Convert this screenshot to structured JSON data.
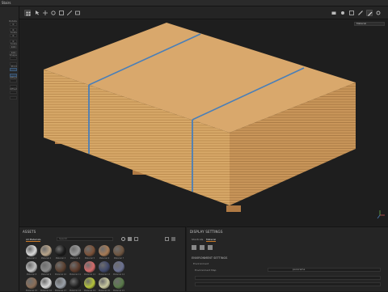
{
  "app": {
    "title": "Stairs"
  },
  "toolbar": {
    "view_dropdown": "Material"
  },
  "left_panel": {
    "fields": [
      {
        "label": "Rotate",
        "value": "0"
      },
      {
        "label": "",
        "value": "0"
      },
      {
        "label": "Scale",
        "value": "0"
      },
      {
        "label": "",
        "value": "0"
      },
      {
        "label": "Scale",
        "value": "100"
      },
      {
        "label": "",
        "value": "100"
      },
      {
        "label": "Shape",
        "value": ""
      },
      {
        "label": "",
        "value": ""
      },
      {
        "label": "Pivot",
        "value": ""
      },
      {
        "label": "",
        "value": ""
      },
      {
        "label": "Offset",
        "value": ""
      },
      {
        "label": "",
        "value": ""
      },
      {
        "label": "Offset",
        "value": ""
      },
      {
        "label": "",
        "value": ""
      }
    ]
  },
  "assets": {
    "title": "ASSETS",
    "tab_label": "All Materials",
    "search_placeholder": "Search",
    "materials": [
      {
        "label": "Material 1",
        "color": "#d9d9d9"
      },
      {
        "label": "Material 2",
        "color": "#b8a48a"
      },
      {
        "label": "Material 3",
        "color": "#1a1a1a"
      },
      {
        "label": "Material 4",
        "color": "#9a9a9a"
      },
      {
        "label": "Material 5",
        "color": "#7a5138"
      },
      {
        "label": "Material 6",
        "color": "#a67a55"
      },
      {
        "label": "Material 7",
        "color": "#6e5540"
      },
      {
        "label": "Material 8",
        "color": "#c0c0c0"
      },
      {
        "label": "Material 9",
        "color": "#8a8a8a"
      },
      {
        "label": "Material 10",
        "color": "#5a4030"
      },
      {
        "label": "Material 11",
        "color": "#5c3a2a"
      },
      {
        "label": "Material 12",
        "color": "#d46a6a"
      },
      {
        "label": "Material 13",
        "color": "#40486a"
      },
      {
        "label": "Material 14",
        "color": "#6a7090"
      },
      {
        "label": "Material 15",
        "color": "#8a6e58"
      },
      {
        "label": "Material 16",
        "color": "#d8d8d8"
      },
      {
        "label": "Material 17",
        "color": "#9aa0a8"
      },
      {
        "label": "Material 18",
        "color": "#1e1e1e"
      },
      {
        "label": "Material 19",
        "color": "#b5c43a"
      },
      {
        "label": "Material 20",
        "color": "#c9c9a0"
      },
      {
        "label": "Material 21",
        "color": "#5a7a4a"
      }
    ]
  },
  "display": {
    "title": "DISPLAY SETTINGS",
    "tabs": [
      "Shortcuts",
      "Material"
    ],
    "section": "ENVIRONMENT SETTINGS",
    "env_label": "Environment",
    "env_file_label": "Environment Map",
    "env_file_value": "panorama"
  },
  "colors": {
    "accent": "#c87a2a",
    "strap": "#4a7fb8",
    "wood": "#d4a56a"
  }
}
